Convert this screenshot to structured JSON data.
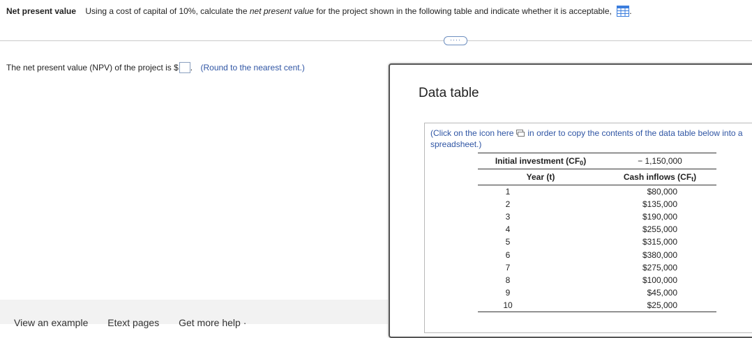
{
  "question": {
    "title": "Net present value",
    "text_before_italic": "Using a cost of capital of 10%, calculate the ",
    "text_italic": "net present value",
    "text_after_italic": " for the project shown in the following table and indicate whether it is acceptable,",
    "trailing": "."
  },
  "more_button_label": "····",
  "answer": {
    "prefix": "The net present value (NPV) of the project is $",
    "suffix": ".",
    "value": "",
    "hint": "(Round to the nearest cent.)"
  },
  "footer_links": [
    "View an example",
    "Etext pages",
    "Get more help ·"
  ],
  "data_table": {
    "title": "Data table",
    "copy_note_before": "(Click on the icon here",
    "copy_note_after": "in order to copy the contents of the data table below into a spreadsheet.)",
    "initial_investment_label": "Initial investment (CF",
    "initial_investment_sub": "0",
    "initial_investment_value": "− 1,150,000",
    "year_header": "Year (t)",
    "cash_header": "Cash inflows (CF",
    "cash_header_sub": "t",
    "rows": [
      {
        "year": "1",
        "cf": "$80,000"
      },
      {
        "year": "2",
        "cf": "$135,000"
      },
      {
        "year": "3",
        "cf": "$190,000"
      },
      {
        "year": "4",
        "cf": "$255,000"
      },
      {
        "year": "5",
        "cf": "$315,000"
      },
      {
        "year": "6",
        "cf": "$380,000"
      },
      {
        "year": "7",
        "cf": "$275,000"
      },
      {
        "year": "8",
        "cf": "$100,000"
      },
      {
        "year": "9",
        "cf": "$45,000"
      },
      {
        "year": "10",
        "cf": "$25,000"
      }
    ]
  },
  "colors": {
    "link": "#2f55a4",
    "icon_blue": "#3b7ddd"
  }
}
